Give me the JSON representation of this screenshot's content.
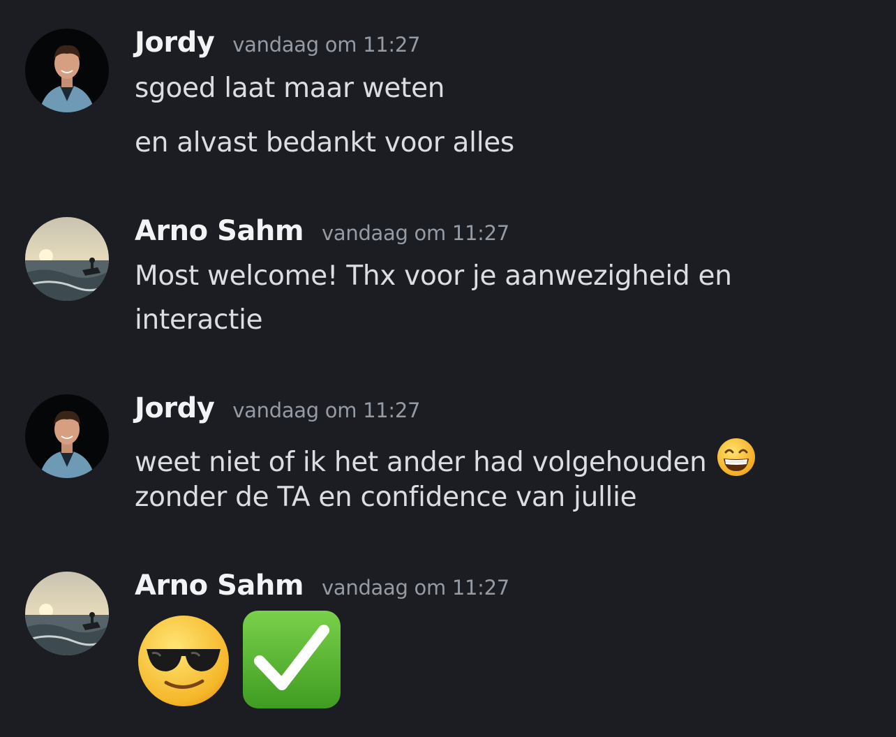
{
  "messages": [
    {
      "author": "Jordy",
      "timestamp": "vandaag om 11:27",
      "avatar": "jordy-avatar",
      "lines": [
        "sgoed laat maar weten",
        "en alvast bedankt voor alles"
      ]
    },
    {
      "author": "Arno Sahm",
      "timestamp": "vandaag om 11:27",
      "avatar": "arno-avatar",
      "lines": [
        "Most welcome! Thx voor je aanwezigheid en",
        "interactie"
      ]
    },
    {
      "author": "Jordy",
      "timestamp": "vandaag om 11:27",
      "avatar": "jordy-avatar",
      "lines": [
        "weet niet of ik het ander had volgehouden",
        "zonder de TA en confidence van jullie"
      ],
      "inline_emoji": "grinning-squinting-face-icon"
    },
    {
      "author": "Arno Sahm",
      "timestamp": "vandaag om 11:27",
      "avatar": "arno-avatar",
      "emojis": [
        "sunglasses-face-icon",
        "check-mark-button-icon"
      ]
    }
  ],
  "colors": {
    "background": "#1c1d22",
    "author": "#f2f3f5",
    "timestamp": "#959ba5",
    "text": "#dcdde1",
    "check_green": "#5cbc2c"
  }
}
